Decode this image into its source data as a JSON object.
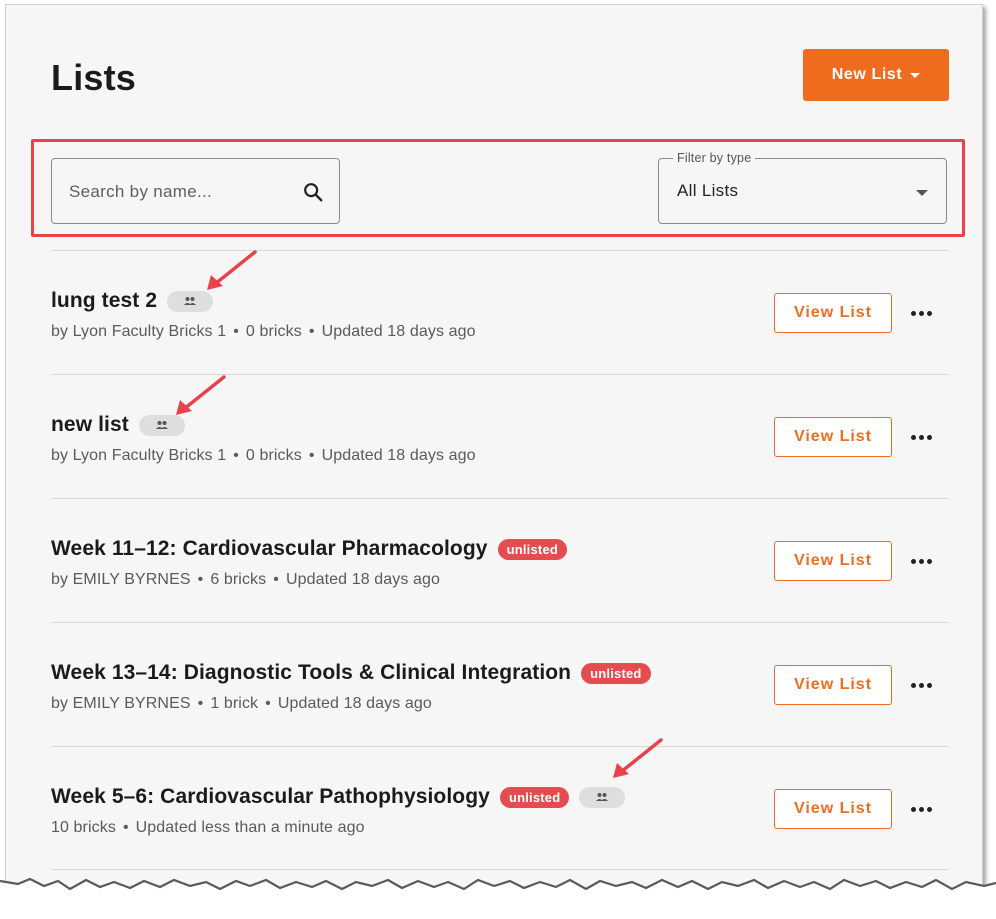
{
  "page": {
    "title": "Lists",
    "new_list_label": "New List"
  },
  "search": {
    "placeholder": "Search by name...",
    "value": ""
  },
  "filter": {
    "label": "Filter by type",
    "value": "All Lists"
  },
  "colors": {
    "accent": "#ef6c1e",
    "unlisted": "#e34d50",
    "highlight": "#e8434a"
  },
  "icons": {
    "search": "search-icon",
    "shared": "shared-users-icon",
    "more": "more-horizontal-icon",
    "dropdown": "caret-down-icon"
  },
  "rows": [
    {
      "title": "lung test 2",
      "shared": true,
      "unlisted": false,
      "meta": [
        "by Lyon Faculty Bricks 1",
        "0 bricks",
        "Updated 18 days ago"
      ],
      "button": "View List"
    },
    {
      "title": "new list",
      "shared": true,
      "unlisted": false,
      "meta": [
        "by Lyon Faculty Bricks 1",
        "0 bricks",
        "Updated 18 days ago"
      ],
      "button": "View List"
    },
    {
      "title": "Week 11–12: Cardiovascular Pharmacology",
      "shared": false,
      "unlisted": true,
      "unlisted_label": "unlisted",
      "meta": [
        "by EMILY BYRNES",
        "6 bricks",
        "Updated 18 days ago"
      ],
      "button": "View List"
    },
    {
      "title": "Week 13–14: Diagnostic Tools & Clinical Integration",
      "shared": false,
      "unlisted": true,
      "unlisted_label": "unlisted",
      "meta": [
        "by EMILY BYRNES",
        "1 brick",
        "Updated 18 days ago"
      ],
      "button": "View List"
    },
    {
      "title": "Week 5–6: Cardiovascular Pathophysiology",
      "shared": true,
      "unlisted": true,
      "unlisted_label": "unlisted",
      "meta": [
        "10 bricks",
        "Updated less than a minute ago"
      ],
      "button": "View List"
    }
  ]
}
